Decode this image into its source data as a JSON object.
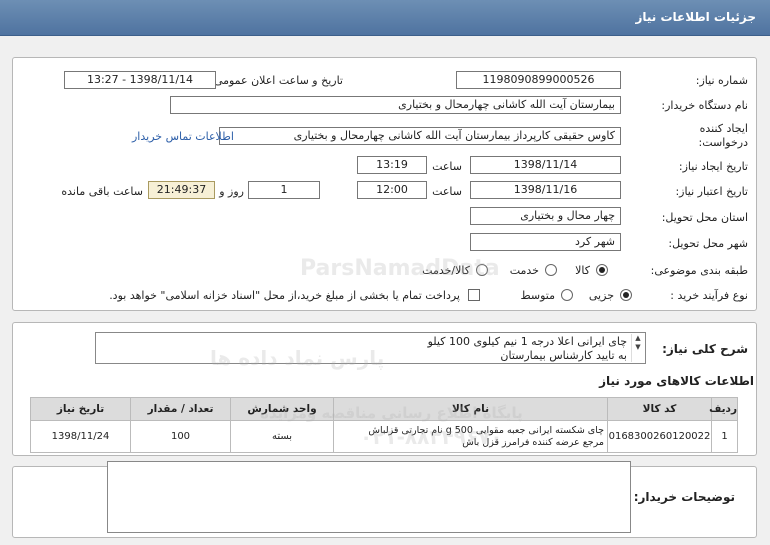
{
  "header": {
    "title": "جزئیات اطلاعات نیاز"
  },
  "need": {
    "number_label": "شماره نیاز:",
    "number": "1198090899000526",
    "announce_label": "تاریخ و ساعت اعلان عمومی:",
    "announce_value": "1398/11/14 - 13:27",
    "buyer_label": "نام دستگاه خریدار:",
    "buyer": "بیمارستان آیت الله کاشانی چهارمحال و بختیاری",
    "creator_label_1": "ایجاد کننده",
    "creator_label_2": "درخواست:",
    "creator": "کاوس حقیقی کارپرداز بیمارستان آیت الله کاشانی چهارمحال و بختیاری",
    "contact_link": "اطلاعات تماس خریدار",
    "create_date_label": "تاریخ ایجاد نیاز:",
    "create_date": "1398/11/14",
    "time_label": "ساعت",
    "create_time": "13:19",
    "valid_label": "تاریخ اعتبار نیاز:",
    "valid_date": "1398/11/16",
    "valid_time": "12:00",
    "days": "1",
    "days_label": "روز و",
    "remaining": "21:49:37",
    "remaining_label": "ساعت باقی مانده",
    "province_label": "استان محل تحویل:",
    "province": "چهار محال و بختیاری",
    "city_label": "شهر محل تحویل:",
    "city": "شهر کرد",
    "category_label": "طبقه بندی موضوعی:",
    "category_options": [
      "کالا",
      "خدمت",
      "کالا/خدمت"
    ],
    "process_label": "نوع فرآیند خرید :",
    "process_options": [
      "جزیی",
      "متوسط"
    ],
    "payment_note": "پرداخت تمام یا بخشی از مبلغ خرید،از محل \"اسناد خزانه اسلامی\" خواهد بود."
  },
  "summary": {
    "label": "شرح کلی نیاز:",
    "line1": "چای ایرانی اعلا درجه 1 نیم کیلوی 100 کیلو",
    "line2": "به تایید کارشناس بیمارستان"
  },
  "goods": {
    "title": "اطلاعات کالاهای مورد نیاز",
    "headers": [
      "ردیف",
      "کد کالا",
      "نام کالا",
      "واحد شمارش",
      "تعداد / مقدار",
      "تاریخ نیاز"
    ],
    "row": {
      "idx": "1",
      "code": "0168300260120022",
      "name_1": "چای شکسته ایرانی جعبه مقوایی 500 g نام تجارتی قزلباش",
      "name_2": "مرجع عرضه کننده فرامرز قزل باش",
      "unit": "بسته",
      "qty": "100",
      "date": "1398/11/24"
    }
  },
  "buyer_notes": {
    "label": "توضیحات خریدار:",
    "value": ""
  },
  "watermark": {
    "line1": "ParsNamadData",
    "line2": "پارس نماد داده ها",
    "line3": "پایگاه اطلاع رسانی مناقصه ومزایده",
    "line4": "۰۲۱-۸۸۳۴۹۶۷۰"
  }
}
